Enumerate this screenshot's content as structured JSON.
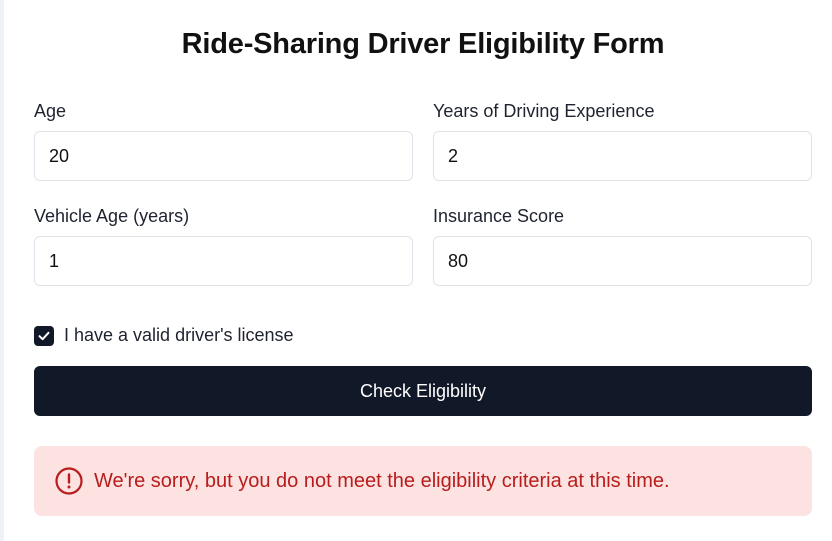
{
  "form": {
    "title": "Ride-Sharing Driver Eligibility Form",
    "fields": {
      "age": {
        "label": "Age",
        "value": "20"
      },
      "experience": {
        "label": "Years of Driving Experience",
        "value": "2"
      },
      "vehicle_age": {
        "label": "Vehicle Age (years)",
        "value": "1"
      },
      "insurance": {
        "label": "Insurance Score",
        "value": "80"
      }
    },
    "license": {
      "label": "I have a valid driver's license",
      "checked": true
    },
    "submit_label": "Check Eligibility"
  },
  "result": {
    "status": "error",
    "message": "We're sorry, but you do not meet the eligibility criteria at this time.",
    "icon": "alert-circle-icon"
  },
  "colors": {
    "primary": "#111827",
    "error_bg": "#fde2e2",
    "error_text": "#b91c1c"
  }
}
